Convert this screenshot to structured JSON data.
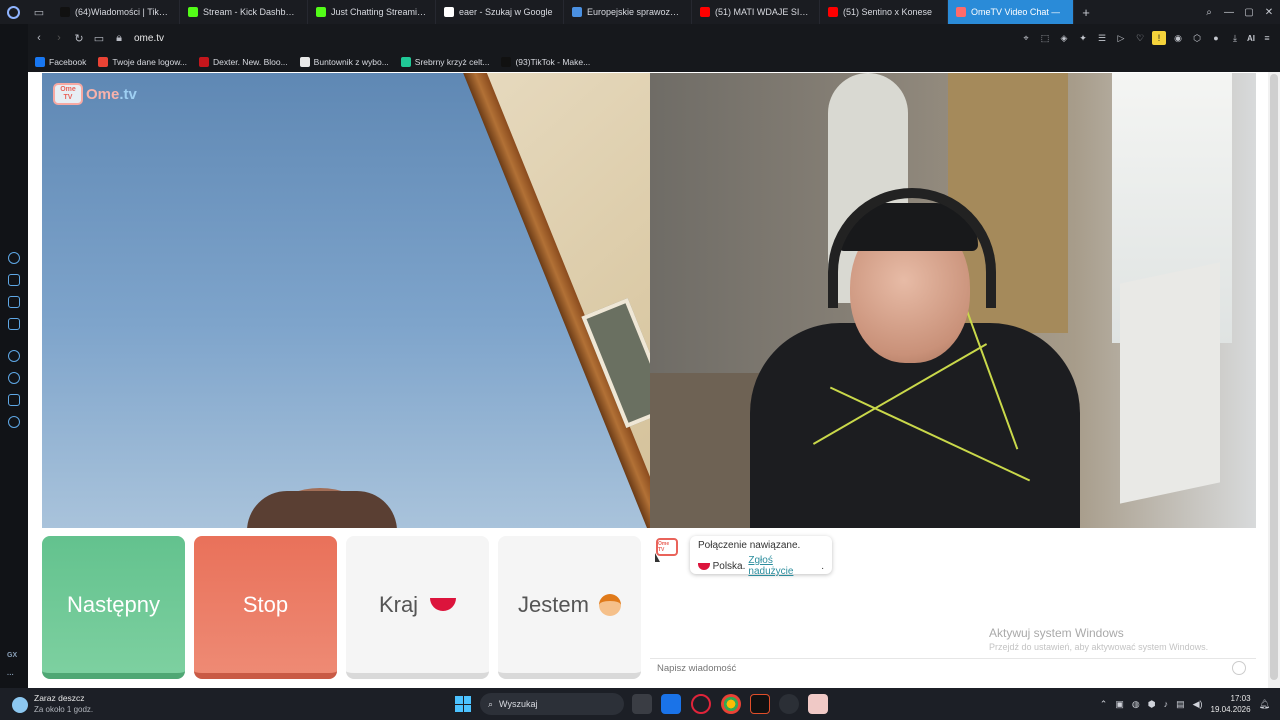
{
  "browser": {
    "tabs": [
      {
        "title": "(64)Wiadomości | TikTok",
        "color": "#111111"
      },
      {
        "title": "Stream - Kick Dashboard",
        "color": "#53fc18"
      },
      {
        "title": "Just Chatting Streaming",
        "color": "#53fc18"
      },
      {
        "title": "eaer - Szukaj w Google",
        "color": "#ffffff"
      },
      {
        "title": "Europejskie sprawozdanie",
        "color": "#4a90e2"
      },
      {
        "title": "(51) MATI WDAJE SIE W D",
        "color": "#ff0000"
      },
      {
        "title": "(51) Sentino x Konese",
        "color": "#ff0000"
      },
      {
        "title": "OmeTV Video Chat —",
        "color": "#ff6b6b",
        "active": true
      }
    ],
    "url": "ome.tv",
    "bookmarks": [
      {
        "label": "Facebook",
        "color": "#1877f2"
      },
      {
        "label": "Twoje dane logow...",
        "color": "#ea4335"
      },
      {
        "label": "Dexter. New. Bloo...",
        "color": "#c4161c"
      },
      {
        "label": "Buntownik z wybo...",
        "color": "#e8e8e8"
      },
      {
        "label": "Srebrny krzyż celt...",
        "color": "#20c997"
      },
      {
        "label": "(93)TikTok - Make...",
        "color": "#111111"
      }
    ],
    "sidebar_label": "GX",
    "ai_label": "AI"
  },
  "app": {
    "logo_text_1": "Ome",
    "logo_text_2": ".tv",
    "logo_badge": "Ome TV",
    "buttons": {
      "next": "Następny",
      "stop": "Stop",
      "country": "Kraj",
      "iam": "Jestem"
    },
    "chat": {
      "message_1": "Połączenie nawiązane.",
      "country": "Polska.",
      "report_link": "Zgłoś nadużycie",
      "report_suffix": ".",
      "input_placeholder": "Napisz wiadomość"
    },
    "watermark": {
      "line1": "Aktywuj system Windows",
      "line2": "Przejdź do ustawień, aby aktywować system Windows."
    }
  },
  "taskbar": {
    "weather_title": "Zaraz deszcz",
    "weather_sub": "Za około 1 godz.",
    "search_label": "Wyszukaj",
    "time": "17:03",
    "date": "19.04.2026"
  },
  "colors": {
    "next_green": "#63c28e",
    "stop_red": "#e9715a",
    "active_tab": "#2a8bd8"
  }
}
